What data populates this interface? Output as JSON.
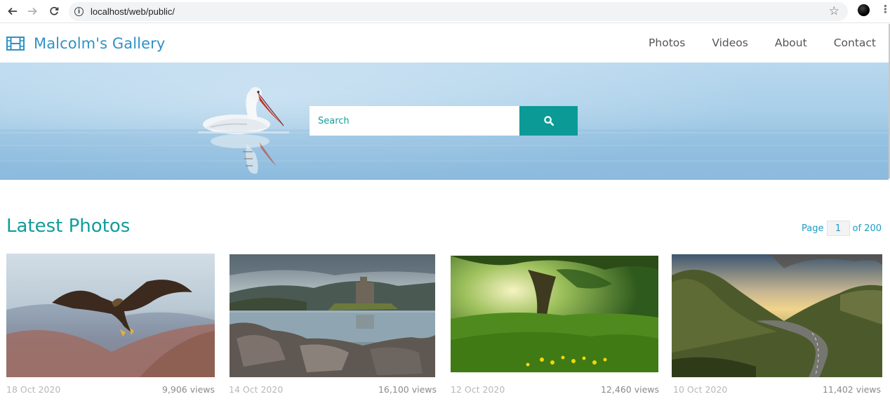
{
  "browser": {
    "url": "localhost/web/public/"
  },
  "site": {
    "brand": "Malcolm's Gallery",
    "nav": [
      "Photos",
      "Videos",
      "About",
      "Contact"
    ],
    "accent": "#0b9a96",
    "brand_color": "#2f93c6"
  },
  "hero": {
    "search_placeholder": "Search",
    "search_icon": "search-icon"
  },
  "latest": {
    "title": "Latest Photos",
    "page_prefix": "Page",
    "page": "1",
    "page_suffix": "of 200"
  },
  "photos": [
    {
      "subject": "eagle",
      "date": "18 Oct 2020",
      "views": "9,906 views"
    },
    {
      "subject": "castle",
      "date": "14 Oct 2020",
      "views": "16,100 views"
    },
    {
      "subject": "forest",
      "date": "12 Oct 2020",
      "views": "12,460 views"
    },
    {
      "subject": "valley-road",
      "date": "10 Oct 2020",
      "views": "11,402 views"
    }
  ]
}
